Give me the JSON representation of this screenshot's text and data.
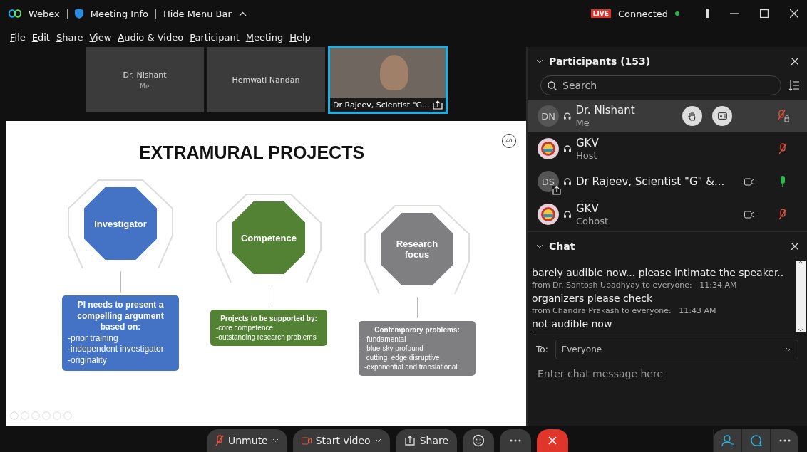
{
  "title_bar": {
    "app_name": "Webex",
    "meeting_info": "Meeting Info",
    "hide_menu": "Hide Menu Bar",
    "live_badge": "LIVE",
    "status": "Connected"
  },
  "menu": [
    "File",
    "Edit",
    "Share",
    "View",
    "Audio & Video",
    "Participant",
    "Meeting",
    "Help"
  ],
  "video_tiles": [
    {
      "kind": "avatar",
      "name": "Dr. Nishant",
      "subtitle": "Me",
      "selected": false
    },
    {
      "kind": "avatar",
      "name": "Hemwati Nandan",
      "selected": false
    },
    {
      "kind": "video",
      "name": "Dr Rajeev, Scientist \"G...",
      "selected": true
    }
  ],
  "slide": {
    "title": "EXTRAMURAL PROJECTS",
    "page_number": "40",
    "columns": [
      {
        "label": "Investigator",
        "color": "#4472c4",
        "box_title": "PI needs to present a compelling argument based on:",
        "box_items": [
          "-prior training",
          "-independent investigator",
          "-originality"
        ]
      },
      {
        "label": "Competence",
        "color": "#548235",
        "box_title": "Projects to be supported by:",
        "box_items": [
          "-core competence",
          "-outstanding research problems"
        ]
      },
      {
        "label": "Research focus",
        "color": "#7f7e80",
        "box_title": "Contemporary problems:",
        "box_items": [
          "-fundamental",
          "-blue-sky profound",
          " cutting  edge disruptive",
          "-exponential and translational"
        ]
      }
    ]
  },
  "participants": {
    "title": "Participants (153)",
    "search": {
      "placeholder": "Search"
    },
    "rows": [
      {
        "kind": "initials",
        "initials": "DN",
        "name": "Dr. Nishant",
        "role": "Me",
        "selected": true,
        "sharing": false,
        "video": false,
        "muted": true,
        "locked": true
      },
      {
        "kind": "logo",
        "name": "GKV",
        "role": "Host",
        "selected": false,
        "sharing": false,
        "video": false,
        "muted": true,
        "locked": false
      },
      {
        "kind": "initials",
        "initials": "DS",
        "name": "Dr Rajeev, Scientist \"G\" &...",
        "selected": false,
        "sharing": true,
        "video": true,
        "muted": false,
        "locked": false
      },
      {
        "kind": "logo",
        "name": "GKV",
        "role": "Cohost",
        "selected": false,
        "sharing": false,
        "video": true,
        "muted": true,
        "locked": false
      }
    ]
  },
  "chat": {
    "title": "Chat",
    "messages": [
      {
        "kind": "text",
        "text": "barely audible now... please intimate the speaker.."
      },
      {
        "kind": "meta",
        "sender": "from Dr. Santosh Upadhyay to everyone:",
        "time": "11:34 AM"
      },
      {
        "kind": "text",
        "text": "organizers please check"
      },
      {
        "kind": "meta",
        "sender": "from Chandra Prakash to everyone:",
        "time": "11:43 AM"
      },
      {
        "kind": "text",
        "text": "not audible now"
      }
    ],
    "to_label": "To:",
    "recipient": "Everyone",
    "placeholder": "Enter chat message here"
  },
  "controls": [
    {
      "kind": "mute",
      "label": "Unmute"
    },
    {
      "kind": "video",
      "label": "Start video"
    },
    {
      "kind": "share",
      "label": "Share"
    },
    {
      "kind": "reactions"
    },
    {
      "kind": "more"
    },
    {
      "kind": "leave"
    }
  ],
  "panel_buttons": [
    {
      "kind": "participants"
    },
    {
      "kind": "chat"
    },
    {
      "kind": "more"
    }
  ]
}
